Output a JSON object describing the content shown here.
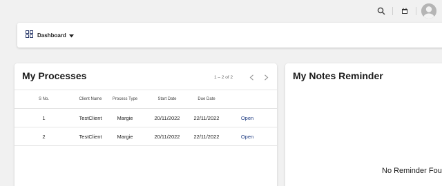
{
  "topbar": {
    "search_icon": "search-icon",
    "calendar_icon": "calendar-icon",
    "avatar_icon": "user-avatar-icon"
  },
  "dashboard": {
    "label": "Dashboard",
    "icon": "dashboard-grid-icon"
  },
  "processes": {
    "title": "My Processes",
    "pagination": "1 – 2 of 2",
    "columns": [
      "S No.",
      "Client Name",
      "Process Type",
      "Start Date",
      "Due Date"
    ],
    "rows": [
      {
        "sno": "1",
        "client": "TestClient",
        "process_type": "Margie",
        "start_date": "20/11/2022",
        "due_date": "22/11/2022",
        "action": "Open"
      },
      {
        "sno": "2",
        "client": "TestClient",
        "process_type": "Margie",
        "start_date": "20/11/2022",
        "due_date": "22/11/2022",
        "action": "Open"
      }
    ]
  },
  "notes": {
    "title": "My Notes Reminder",
    "empty_text": "No Reminder Fou"
  },
  "colors": {
    "background": "#f1f1f1",
    "card": "#ffffff",
    "link": "#1f3c82"
  }
}
